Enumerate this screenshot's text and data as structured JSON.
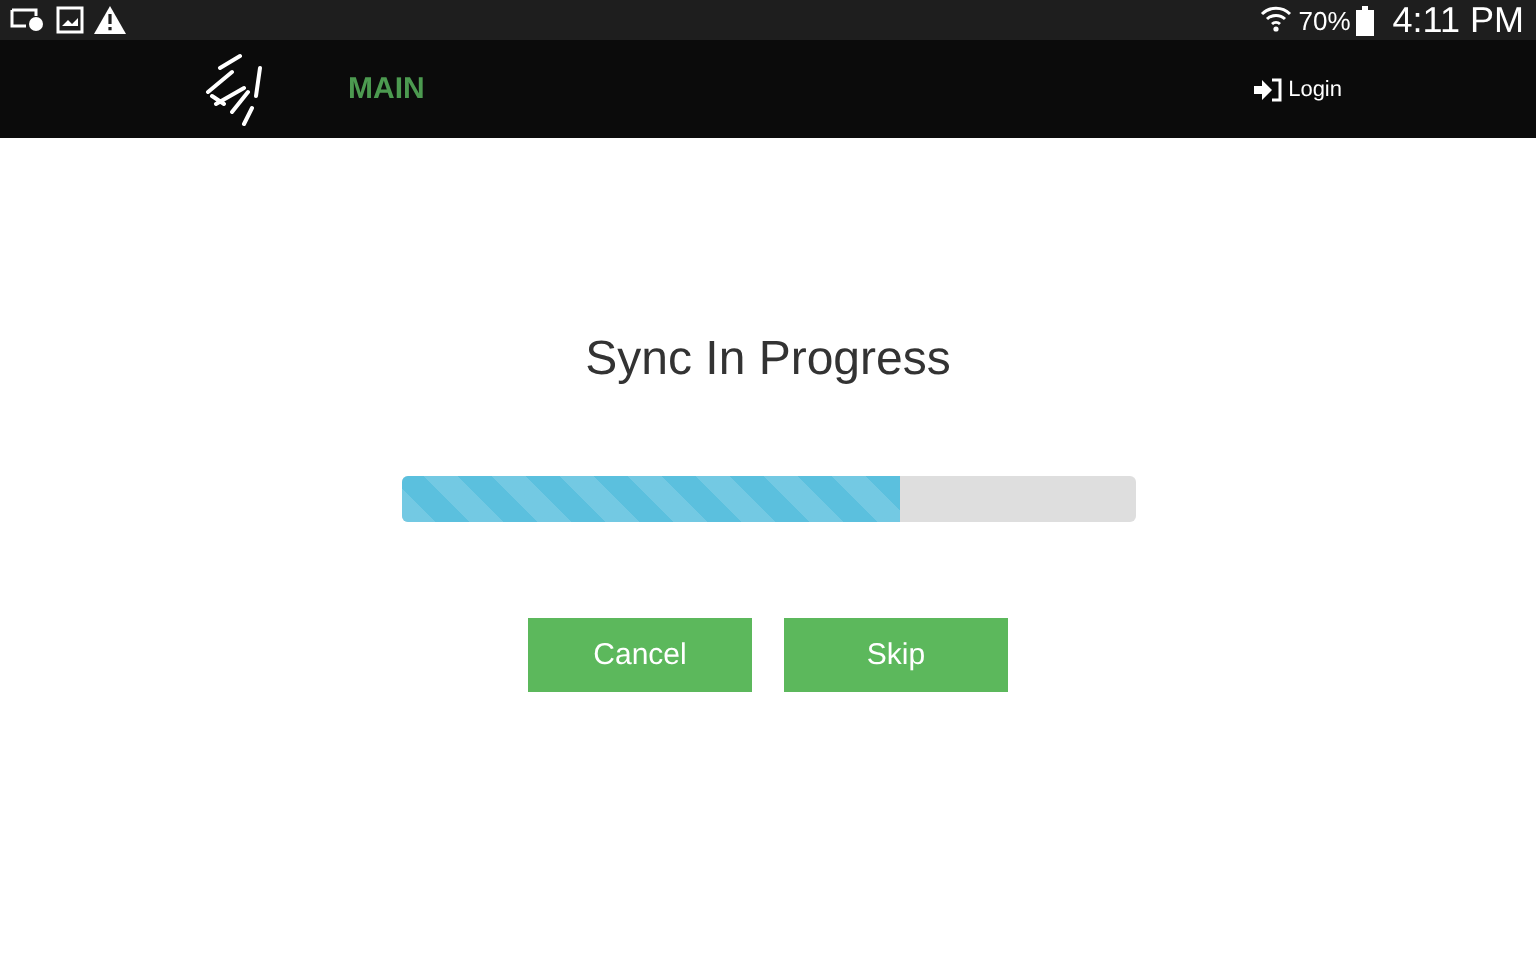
{
  "status_bar": {
    "battery": "70%",
    "time": "4:11 PM"
  },
  "nav": {
    "title": "MAIN",
    "login": "Login"
  },
  "sync": {
    "title": "Sync In Progress",
    "level": 0.68
  },
  "buttons": [
    "Cancel",
    "Skip"
  ]
}
